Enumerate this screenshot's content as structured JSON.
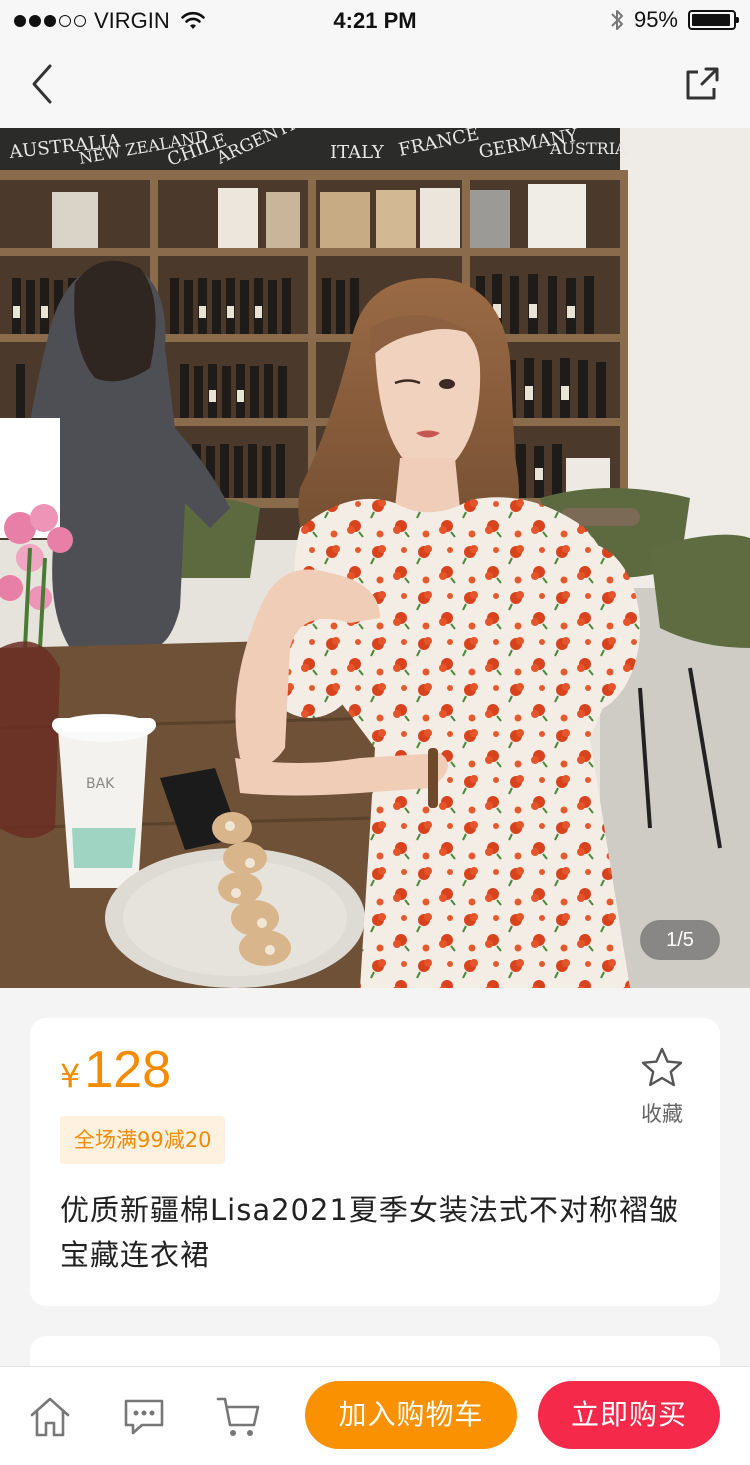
{
  "status_bar": {
    "carrier": "VIRGIN",
    "time": "4:21 PM",
    "battery_percent": "95%",
    "battery_level": 0.95,
    "signal_bars_filled": 3,
    "signal_bars_total": 5
  },
  "nav": {
    "back_icon": "chevron-left-icon",
    "share_icon": "share-external-icon"
  },
  "gallery": {
    "indicator": "1/5",
    "current": 1,
    "total": 5
  },
  "product": {
    "currency": "¥",
    "price": "128",
    "promo": "全场满99减20",
    "title": "优质新疆棉Lisa2021夏季女装法式不对称褶皱宝藏连衣裙",
    "favorite_label": "收藏",
    "favorite_icon": "star-outline-icon"
  },
  "bottom_bar": {
    "add_to_cart": "加入购物车",
    "buy_now": "立即购买",
    "icons": [
      "home-icon",
      "chat-icon",
      "cart-icon"
    ]
  },
  "colors": {
    "price": "#f58b00",
    "promo_bg": "#fff1e0",
    "cart_button": "#fa9100",
    "buy_button": "#f5294a"
  }
}
